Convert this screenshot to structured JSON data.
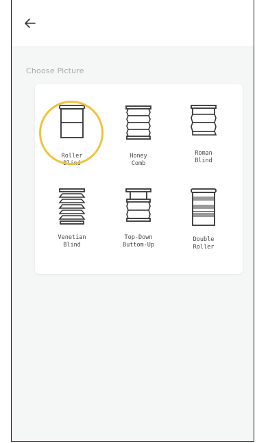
{
  "header": {
    "back_icon": "arrow-left-icon"
  },
  "section": {
    "title": "Choose Picture"
  },
  "colors": {
    "selection_ring": "#f0c23e",
    "background": "#f5f6f6",
    "card": "#ffffff"
  },
  "options": [
    {
      "id": "roller",
      "line1": "Roller",
      "line2": "Blind",
      "icon": "roller-blind-icon",
      "selected": true
    },
    {
      "id": "honeycomb",
      "line1": "Honey",
      "line2": "Comb",
      "icon": "honeycomb-blind-icon",
      "selected": false
    },
    {
      "id": "roman",
      "line1": "Roman",
      "line2": "Blind",
      "icon": "roman-blind-icon",
      "selected": false
    },
    {
      "id": "venetian",
      "line1": "Venetian",
      "line2": "Blind",
      "icon": "venetian-blind-icon",
      "selected": false
    },
    {
      "id": "topdown",
      "line1": "Top-Down",
      "line2": "Buttom-Up",
      "icon": "top-down-bottom-up-blind-icon",
      "selected": false
    },
    {
      "id": "double",
      "line1": "Double",
      "line2": "Roller",
      "icon": "double-roller-blind-icon",
      "selected": false
    }
  ]
}
